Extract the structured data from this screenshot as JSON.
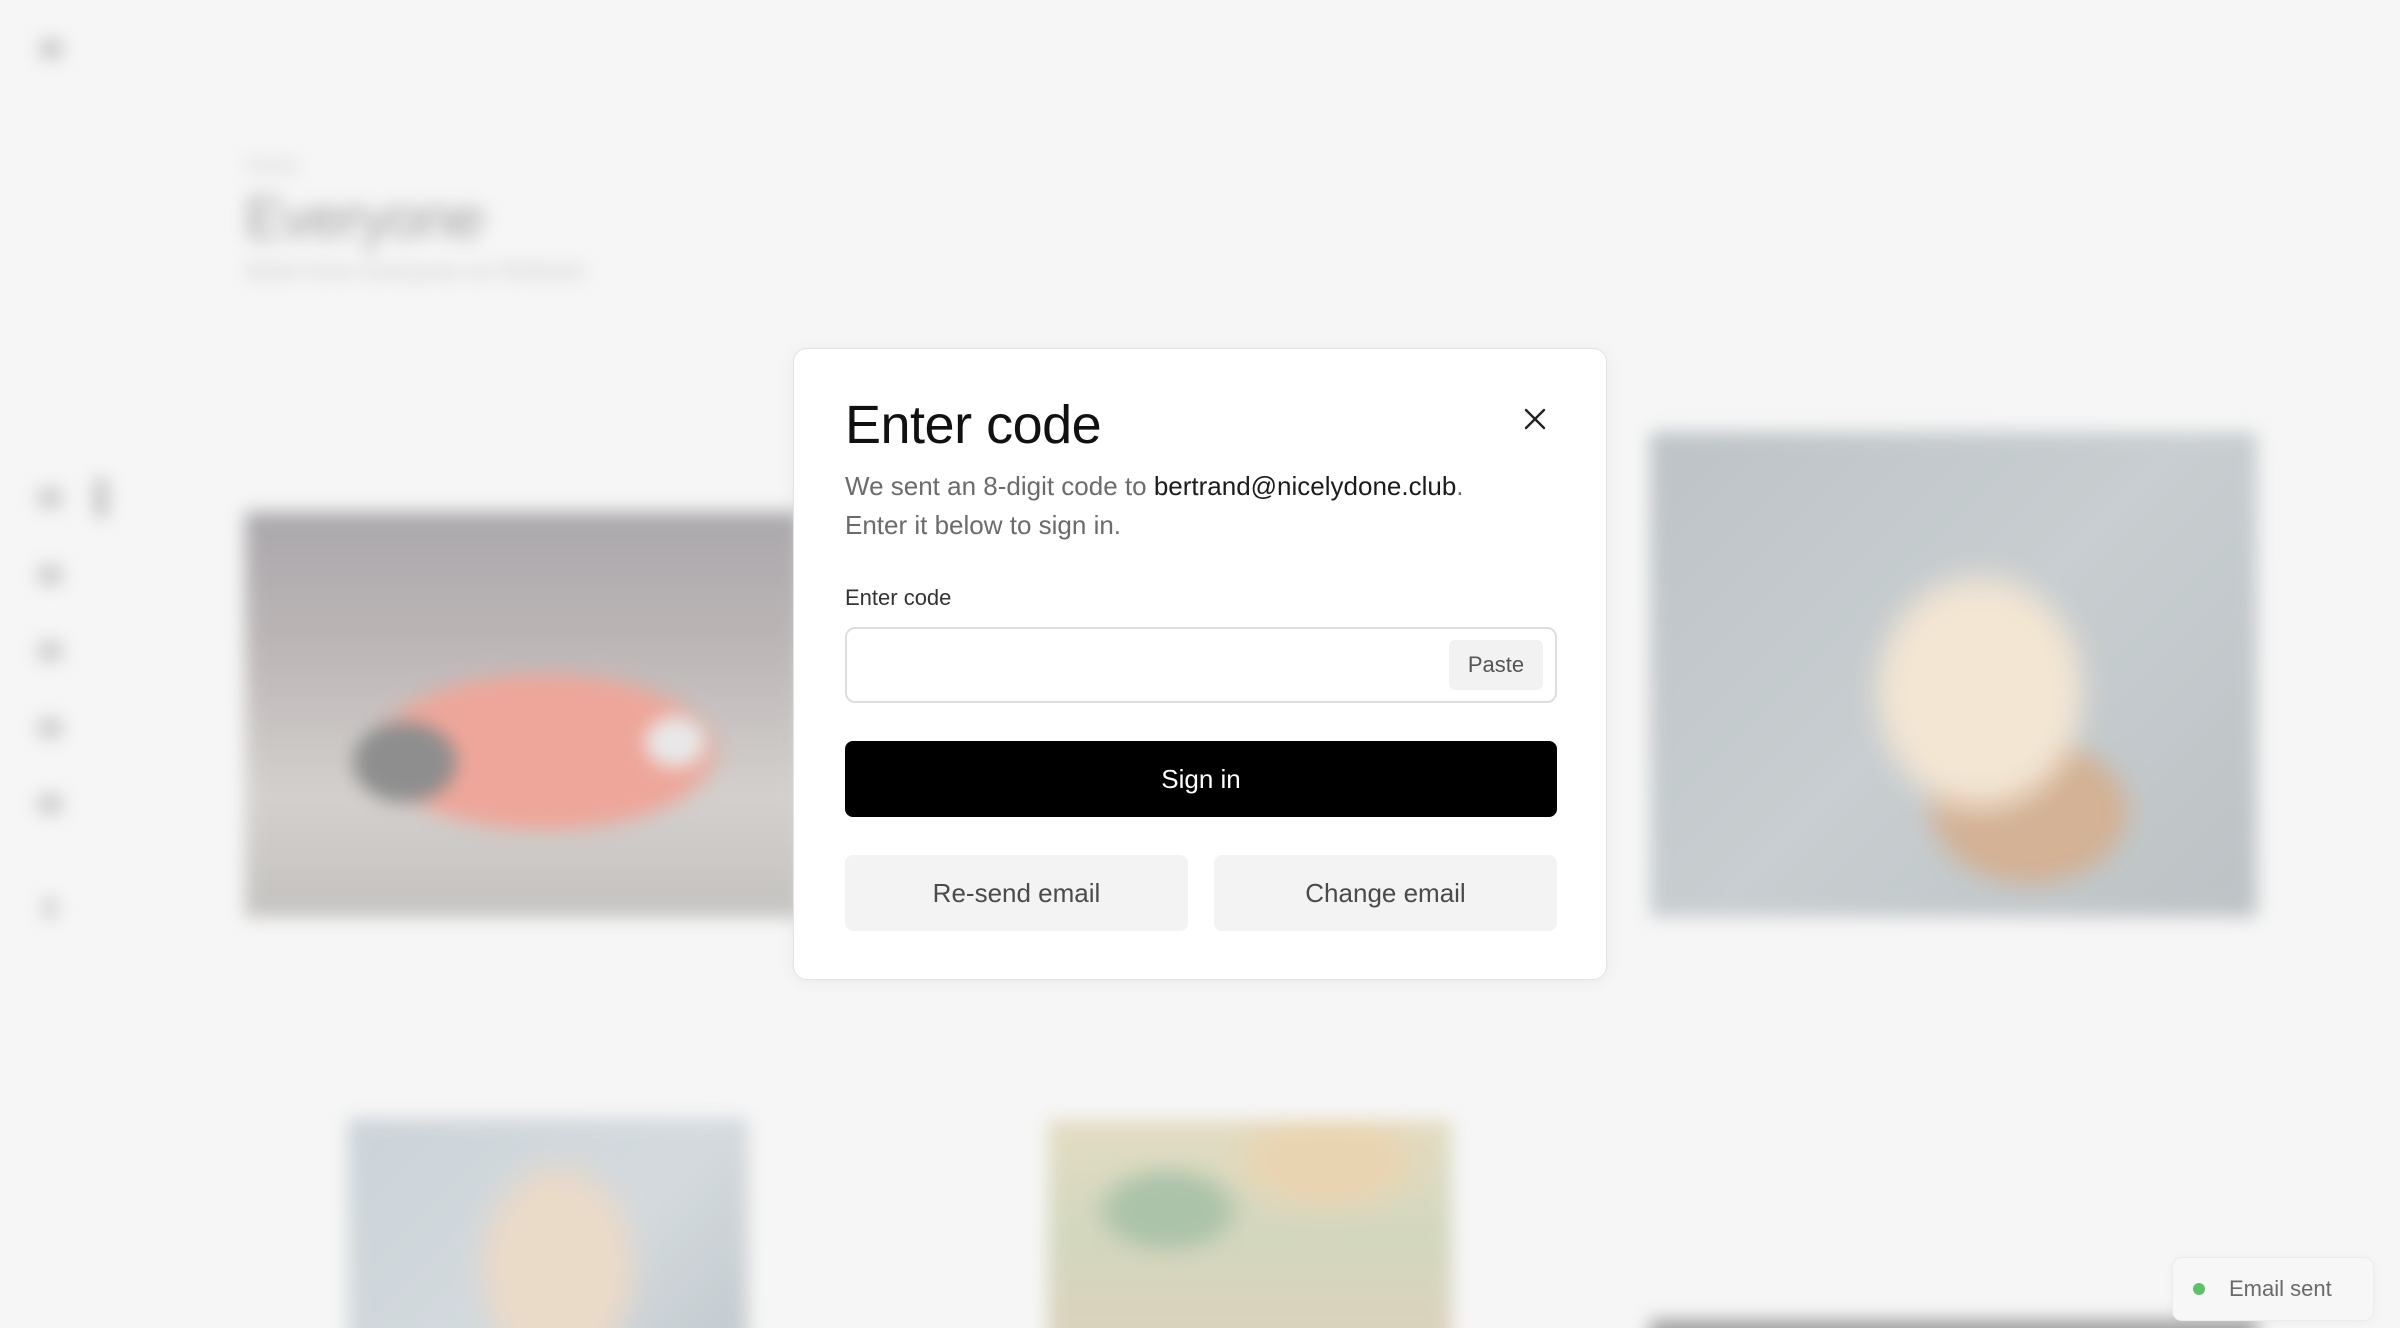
{
  "background": {
    "breadcrumb": "Home",
    "title": "Everyone",
    "subtitle": "Work from everyone on Refresh"
  },
  "modal": {
    "title": "Enter code",
    "description_prefix": "We sent an 8-digit code to ",
    "email": "bertrand@nicelydone.club",
    "description_suffix": ".",
    "description_line2": "Enter it below to sign in.",
    "code_label": "Enter code",
    "code_value": "",
    "paste_label": "Paste",
    "signin_label": "Sign in",
    "resend_label": "Re-send email",
    "change_label": "Change email",
    "close_icon": "close-icon"
  },
  "toast": {
    "text": "Email sent",
    "dot_color": "#5cc26a"
  },
  "colors": {
    "primary_button": "#000000",
    "secondary_button": "#f3f3f3",
    "page_background": "#f6f6f6"
  }
}
